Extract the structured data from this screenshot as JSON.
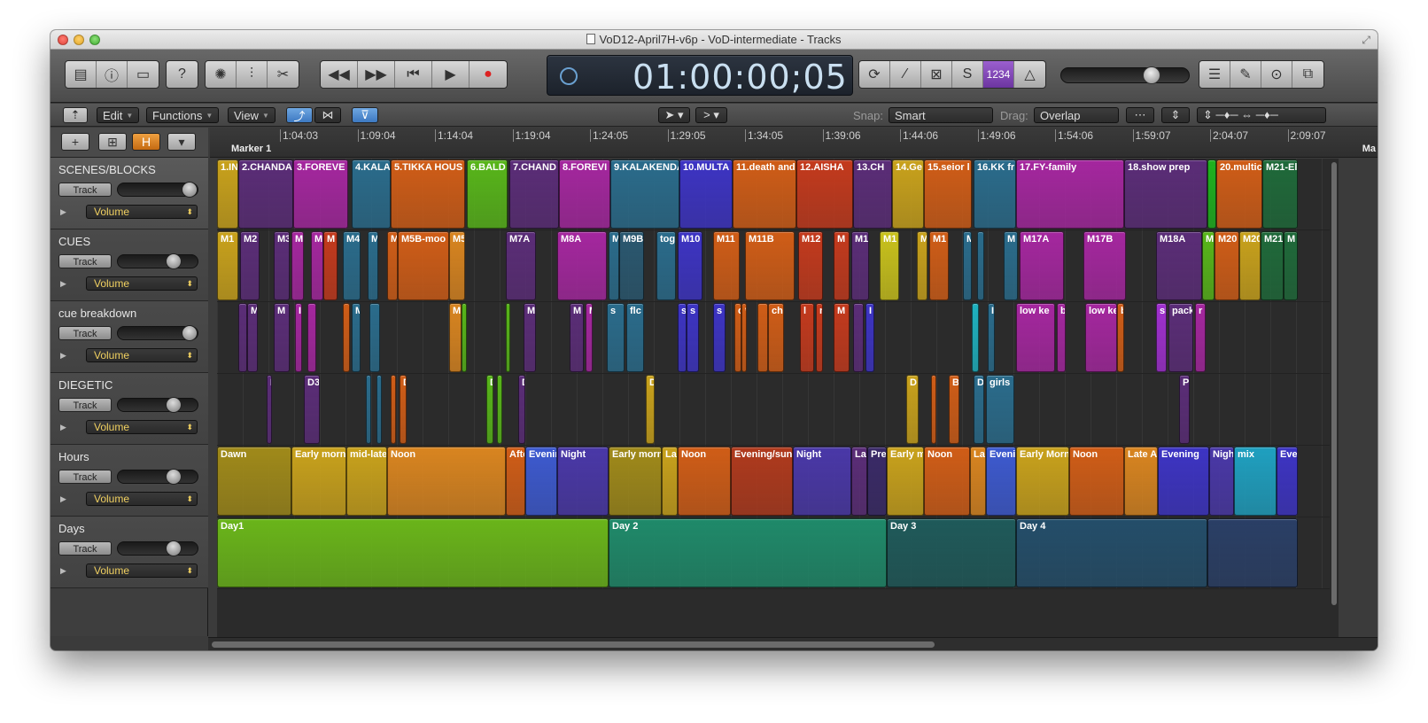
{
  "window": {
    "title": "VoD12-April7H-v6p - VoD-intermediate - Tracks"
  },
  "transport": {
    "time": "01:00:00;05",
    "count_in": "1234"
  },
  "menus": {
    "edit": "Edit",
    "functions": "Functions",
    "view": "View"
  },
  "snap": {
    "label": "Snap:",
    "value": "Smart"
  },
  "drag": {
    "label": "Drag:",
    "value": "Overlap"
  },
  "ruler": {
    "ticks": [
      "1:04:03",
      "1:09:04",
      "1:14:04",
      "1:19:04",
      "1:24:05",
      "1:29:05",
      "1:34:05",
      "1:39:06",
      "1:44:06",
      "1:49:06",
      "1:54:06",
      "1:59:07",
      "2:04:07",
      "2:09:07"
    ],
    "marker": "Marker 1",
    "marker_right": "Ma"
  },
  "tracks": [
    {
      "name": "SCENES/BLOCKS",
      "track_btn": "Track",
      "automation": "Volume",
      "knob": 1.0
    },
    {
      "name": "CUES",
      "track_btn": "Track",
      "automation": "Volume",
      "knob": 0.75
    },
    {
      "name": "cue breakdown",
      "track_btn": "Track",
      "automation": "Volume",
      "knob": 1.0
    },
    {
      "name": "DIEGETIC",
      "track_btn": "Track",
      "automation": "Volume",
      "knob": 0.75
    },
    {
      "name": "Hours",
      "track_btn": "Track",
      "automation": "Volume",
      "knob": 0.75
    },
    {
      "name": "Days",
      "track_btn": "Track",
      "automation": "Volume",
      "knob": 0.75
    }
  ],
  "regions": [
    {
      "track": 0,
      "start": 0,
      "end": 24,
      "label": "1.IN",
      "color": "#c9a21c"
    },
    {
      "track": 0,
      "start": 24,
      "end": 86,
      "label": "2.CHANDA",
      "color": "#5b2d78"
    },
    {
      "track": 0,
      "start": 86,
      "end": 148,
      "label": "3.FOREVE",
      "color": "#a5279f"
    },
    {
      "track": 0,
      "start": 152,
      "end": 196,
      "label": "4.KALA",
      "color": "#2a6c8c"
    },
    {
      "track": 0,
      "start": 196,
      "end": 280,
      "label": "5.TIKKA HOUS",
      "color": "#d05d17"
    },
    {
      "track": 0,
      "start": 282,
      "end": 328,
      "label": "6.BALD",
      "color": "#58b61a"
    },
    {
      "track": 0,
      "start": 330,
      "end": 386,
      "label": "7.CHAND",
      "color": "#5b2d78"
    },
    {
      "track": 0,
      "start": 386,
      "end": 444,
      "label": "8.FOREVI",
      "color": "#a5279f"
    },
    {
      "track": 0,
      "start": 444,
      "end": 522,
      "label": "9.KALAKENDA",
      "color": "#2a6c8c"
    },
    {
      "track": 0,
      "start": 522,
      "end": 582,
      "label": "10.MULTA",
      "color": "#3d34c4"
    },
    {
      "track": 0,
      "start": 582,
      "end": 654,
      "label": "11.death and",
      "color": "#d05d17"
    },
    {
      "track": 0,
      "start": 654,
      "end": 718,
      "label": "12.AISHA",
      "color": "#c43a1d"
    },
    {
      "track": 0,
      "start": 718,
      "end": 762,
      "label": "13.CH",
      "color": "#5b2d78"
    },
    {
      "track": 0,
      "start": 762,
      "end": 798,
      "label": "14.Ge",
      "color": "#c9a21c"
    },
    {
      "track": 0,
      "start": 798,
      "end": 852,
      "label": "15.seior l",
      "color": "#d05d17"
    },
    {
      "track": 0,
      "start": 854,
      "end": 902,
      "label": "16.KK fr",
      "color": "#2a6c8c"
    },
    {
      "track": 0,
      "start": 902,
      "end": 1024,
      "label": "17.FY-family",
      "color": "#a5279f"
    },
    {
      "track": 0,
      "start": 1024,
      "end": 1118,
      "label": "18.show prep",
      "color": "#5b2d78"
    },
    {
      "track": 0,
      "start": 1118,
      "end": 1128,
      "label": "",
      "color": "#1fb21f"
    },
    {
      "track": 0,
      "start": 1128,
      "end": 1180,
      "label": "20.multic",
      "color": "#d05d17"
    },
    {
      "track": 0,
      "start": 1180,
      "end": 1220,
      "label": "M21-El",
      "color": "#1f6a3a"
    },
    {
      "track": 1,
      "start": 0,
      "end": 24,
      "label": "M1",
      "color": "#c9a21c"
    },
    {
      "track": 1,
      "start": 26,
      "end": 48,
      "label": "M2",
      "color": "#5b2d78"
    },
    {
      "track": 1,
      "start": 64,
      "end": 82,
      "label": "M3",
      "color": "#5b2d78"
    },
    {
      "track": 1,
      "start": 84,
      "end": 98,
      "label": "M",
      "color": "#a5279f"
    },
    {
      "track": 1,
      "start": 106,
      "end": 120,
      "label": "M",
      "color": "#a5279f"
    },
    {
      "track": 1,
      "start": 120,
      "end": 136,
      "label": "M",
      "color": "#c43a1d"
    },
    {
      "track": 1,
      "start": 142,
      "end": 162,
      "label": "M4",
      "color": "#2a6c8c"
    },
    {
      "track": 1,
      "start": 170,
      "end": 182,
      "label": "M",
      "color": "#2a6c8c"
    },
    {
      "track": 1,
      "start": 192,
      "end": 204,
      "label": "M",
      "color": "#d05d17"
    },
    {
      "track": 1,
      "start": 204,
      "end": 262,
      "label": "M5B-moo",
      "color": "#d05d17"
    },
    {
      "track": 1,
      "start": 262,
      "end": 280,
      "label": "M5",
      "color": "#d98520"
    },
    {
      "track": 1,
      "start": 326,
      "end": 360,
      "label": "M7A",
      "color": "#5b2d78"
    },
    {
      "track": 1,
      "start": 384,
      "end": 440,
      "label": "M8A",
      "color": "#a5279f"
    },
    {
      "track": 1,
      "start": 442,
      "end": 454,
      "label": "M",
      "color": "#2a6c8c"
    },
    {
      "track": 1,
      "start": 454,
      "end": 482,
      "label": "M9B",
      "color": "#2a5870"
    },
    {
      "track": 1,
      "start": 496,
      "end": 518,
      "label": "tog",
      "color": "#2a6c8c"
    },
    {
      "track": 1,
      "start": 520,
      "end": 548,
      "label": "M10",
      "color": "#3d34c4"
    },
    {
      "track": 1,
      "start": 560,
      "end": 590,
      "label": "M11",
      "color": "#d05d17"
    },
    {
      "track": 1,
      "start": 596,
      "end": 652,
      "label": "M11B",
      "color": "#d05d17"
    },
    {
      "track": 1,
      "start": 656,
      "end": 684,
      "label": "M12",
      "color": "#c43a1d"
    },
    {
      "track": 1,
      "start": 696,
      "end": 714,
      "label": "M",
      "color": "#c43a1d"
    },
    {
      "track": 1,
      "start": 716,
      "end": 736,
      "label": "M1",
      "color": "#5b2d78"
    },
    {
      "track": 1,
      "start": 748,
      "end": 770,
      "label": "M1",
      "color": "#c9c21c"
    },
    {
      "track": 1,
      "start": 790,
      "end": 802,
      "label": "M",
      "color": "#c9a21c"
    },
    {
      "track": 1,
      "start": 804,
      "end": 826,
      "label": "M1",
      "color": "#d05d17"
    },
    {
      "track": 1,
      "start": 842,
      "end": 852,
      "label": "M",
      "color": "#2a6c8c"
    },
    {
      "track": 1,
      "start": 858,
      "end": 866,
      "label": "",
      "color": "#2a6c8c"
    },
    {
      "track": 1,
      "start": 888,
      "end": 904,
      "label": "M",
      "color": "#2a6c8c"
    },
    {
      "track": 1,
      "start": 906,
      "end": 956,
      "label": "M17A",
      "color": "#a5279f"
    },
    {
      "track": 1,
      "start": 978,
      "end": 1026,
      "label": "M17B",
      "color": "#a5279f"
    },
    {
      "track": 1,
      "start": 1060,
      "end": 1112,
      "label": "M18A",
      "color": "#5b2d78"
    },
    {
      "track": 1,
      "start": 1112,
      "end": 1126,
      "label": "M",
      "color": "#58b61a"
    },
    {
      "track": 1,
      "start": 1126,
      "end": 1154,
      "label": "M20",
      "color": "#d05d17"
    },
    {
      "track": 1,
      "start": 1154,
      "end": 1178,
      "label": "M20",
      "color": "#c9a21c"
    },
    {
      "track": 1,
      "start": 1178,
      "end": 1204,
      "label": "M21",
      "color": "#1f6a3a"
    },
    {
      "track": 1,
      "start": 1204,
      "end": 1220,
      "label": "M",
      "color": "#1f6a3a"
    },
    {
      "track": 2,
      "start": 24,
      "end": 34,
      "label": "",
      "color": "#5b2d78"
    },
    {
      "track": 2,
      "start": 34,
      "end": 46,
      "label": "M",
      "color": "#5b2d78"
    },
    {
      "track": 2,
      "start": 64,
      "end": 82,
      "label": "M",
      "color": "#5b2d78"
    },
    {
      "track": 2,
      "start": 88,
      "end": 96,
      "label": "I",
      "color": "#a5279f"
    },
    {
      "track": 2,
      "start": 102,
      "end": 112,
      "label": "",
      "color": "#a5279f"
    },
    {
      "track": 2,
      "start": 142,
      "end": 150,
      "label": "",
      "color": "#d05d17"
    },
    {
      "track": 2,
      "start": 152,
      "end": 162,
      "label": "M",
      "color": "#2a6c8c"
    },
    {
      "track": 2,
      "start": 172,
      "end": 184,
      "label": "",
      "color": "#2a6c8c"
    },
    {
      "track": 2,
      "start": 262,
      "end": 276,
      "label": "M",
      "color": "#d98520"
    },
    {
      "track": 2,
      "start": 276,
      "end": 282,
      "label": "",
      "color": "#58b61a"
    },
    {
      "track": 2,
      "start": 326,
      "end": 330,
      "label": "",
      "color": "#58b61a"
    },
    {
      "track": 2,
      "start": 346,
      "end": 360,
      "label": "M",
      "color": "#5b2d78"
    },
    {
      "track": 2,
      "start": 398,
      "end": 414,
      "label": "M",
      "color": "#5b2d78"
    },
    {
      "track": 2,
      "start": 416,
      "end": 424,
      "label": "M",
      "color": "#a5279f"
    },
    {
      "track": 2,
      "start": 440,
      "end": 460,
      "label": "s",
      "color": "#2a6c8c"
    },
    {
      "track": 2,
      "start": 462,
      "end": 482,
      "label": "flc",
      "color": "#2a6c8c"
    },
    {
      "track": 2,
      "start": 520,
      "end": 530,
      "label": "s",
      "color": "#3d34c4"
    },
    {
      "track": 2,
      "start": 530,
      "end": 544,
      "label": "s",
      "color": "#3d34c4"
    },
    {
      "track": 2,
      "start": 560,
      "end": 574,
      "label": "s",
      "color": "#3d34c4"
    },
    {
      "track": 2,
      "start": 584,
      "end": 592,
      "label": "c",
      "color": "#d05d17"
    },
    {
      "track": 2,
      "start": 592,
      "end": 598,
      "label": "*",
      "color": "#d05d17"
    },
    {
      "track": 2,
      "start": 610,
      "end": 622,
      "label": "",
      "color": "#d05d17"
    },
    {
      "track": 2,
      "start": 622,
      "end": 640,
      "label": "cha",
      "color": "#d05d17"
    },
    {
      "track": 2,
      "start": 658,
      "end": 674,
      "label": "l",
      "color": "#c43a1d"
    },
    {
      "track": 2,
      "start": 676,
      "end": 684,
      "label": "n",
      "color": "#c43a1d"
    },
    {
      "track": 2,
      "start": 696,
      "end": 714,
      "label": "M",
      "color": "#c43a1d"
    },
    {
      "track": 2,
      "start": 718,
      "end": 730,
      "label": "",
      "color": "#5b2d78"
    },
    {
      "track": 2,
      "start": 732,
      "end": 742,
      "label": "I",
      "color": "#3d34c4"
    },
    {
      "track": 2,
      "start": 852,
      "end": 860,
      "label": "",
      "color": "#1fb2c0"
    },
    {
      "track": 2,
      "start": 870,
      "end": 878,
      "label": "I",
      "color": "#2a6c8c"
    },
    {
      "track": 2,
      "start": 902,
      "end": 946,
      "label": "low ke",
      "color": "#a5279f"
    },
    {
      "track": 2,
      "start": 948,
      "end": 958,
      "label": "b",
      "color": "#a5279f"
    },
    {
      "track": 2,
      "start": 980,
      "end": 1016,
      "label": "low ke",
      "color": "#a5279f"
    },
    {
      "track": 2,
      "start": 1016,
      "end": 1024,
      "label": "b",
      "color": "#d05d17"
    },
    {
      "track": 2,
      "start": 1060,
      "end": 1072,
      "label": "sl",
      "color": "#a030d0"
    },
    {
      "track": 2,
      "start": 1074,
      "end": 1102,
      "label": "pack",
      "color": "#5b2d78"
    },
    {
      "track": 2,
      "start": 1104,
      "end": 1116,
      "label": "r",
      "color": "#a5279f"
    },
    {
      "track": 3,
      "start": 56,
      "end": 62,
      "label": "I",
      "color": "#5b2d78"
    },
    {
      "track": 3,
      "start": 98,
      "end": 116,
      "label": "D3",
      "color": "#5b2d78"
    },
    {
      "track": 3,
      "start": 168,
      "end": 174,
      "label": "",
      "color": "#2a6c8c"
    },
    {
      "track": 3,
      "start": 180,
      "end": 186,
      "label": "",
      "color": "#2a6c8c"
    },
    {
      "track": 3,
      "start": 196,
      "end": 202,
      "label": "",
      "color": "#d05d17"
    },
    {
      "track": 3,
      "start": 206,
      "end": 214,
      "label": "D",
      "color": "#d05d17"
    },
    {
      "track": 3,
      "start": 304,
      "end": 312,
      "label": "D",
      "color": "#58b61a"
    },
    {
      "track": 3,
      "start": 316,
      "end": 322,
      "label": "",
      "color": "#58b61a"
    },
    {
      "track": 3,
      "start": 340,
      "end": 348,
      "label": "D",
      "color": "#5b2d78"
    },
    {
      "track": 3,
      "start": 484,
      "end": 494,
      "label": "D",
      "color": "#c9a21c"
    },
    {
      "track": 3,
      "start": 778,
      "end": 792,
      "label": "D",
      "color": "#c9a21c"
    },
    {
      "track": 3,
      "start": 806,
      "end": 812,
      "label": "",
      "color": "#d05d17"
    },
    {
      "track": 3,
      "start": 826,
      "end": 838,
      "label": "B",
      "color": "#d05d17"
    },
    {
      "track": 3,
      "start": 854,
      "end": 866,
      "label": "D",
      "color": "#2a6c8c"
    },
    {
      "track": 3,
      "start": 868,
      "end": 900,
      "label": "girls",
      "color": "#2a6c8c"
    },
    {
      "track": 3,
      "start": 1086,
      "end": 1098,
      "label": "P",
      "color": "#5b2d78"
    },
    {
      "track": 4,
      "start": 0,
      "end": 84,
      "label": "Dawn",
      "color": "#a08a1a"
    },
    {
      "track": 4,
      "start": 84,
      "end": 146,
      "label": "Early morn",
      "color": "#c9a21c"
    },
    {
      "track": 4,
      "start": 146,
      "end": 192,
      "label": "mid-late",
      "color": "#c9a21c"
    },
    {
      "track": 4,
      "start": 192,
      "end": 326,
      "label": "Noon",
      "color": "#d98520"
    },
    {
      "track": 4,
      "start": 326,
      "end": 348,
      "label": "Afte",
      "color": "#d05d17"
    },
    {
      "track": 4,
      "start": 348,
      "end": 384,
      "label": "Evenin",
      "color": "#3d5ad0"
    },
    {
      "track": 4,
      "start": 384,
      "end": 442,
      "label": "Night",
      "color": "#4a38a8"
    },
    {
      "track": 4,
      "start": 442,
      "end": 502,
      "label": "Early morn",
      "color": "#a08a1a"
    },
    {
      "track": 4,
      "start": 502,
      "end": 520,
      "label": "La",
      "color": "#c9a21c"
    },
    {
      "track": 4,
      "start": 520,
      "end": 580,
      "label": "Noon",
      "color": "#d05d17"
    },
    {
      "track": 4,
      "start": 580,
      "end": 650,
      "label": "Evening/sun",
      "color": "#b03a1d"
    },
    {
      "track": 4,
      "start": 650,
      "end": 716,
      "label": "Night",
      "color": "#4a38a8"
    },
    {
      "track": 4,
      "start": 716,
      "end": 734,
      "label": "La",
      "color": "#5b2d78"
    },
    {
      "track": 4,
      "start": 734,
      "end": 756,
      "label": "Pre",
      "color": "#3a2a68"
    },
    {
      "track": 4,
      "start": 756,
      "end": 798,
      "label": "Early m",
      "color": "#c9a21c"
    },
    {
      "track": 4,
      "start": 798,
      "end": 850,
      "label": "Noon",
      "color": "#d05d17"
    },
    {
      "track": 4,
      "start": 850,
      "end": 868,
      "label": "La",
      "color": "#d98520"
    },
    {
      "track": 4,
      "start": 868,
      "end": 902,
      "label": "Eveni",
      "color": "#3d5ad0"
    },
    {
      "track": 4,
      "start": 902,
      "end": 962,
      "label": "Early Morn",
      "color": "#c9a21c"
    },
    {
      "track": 4,
      "start": 962,
      "end": 1024,
      "label": "Noon",
      "color": "#d05d17"
    },
    {
      "track": 4,
      "start": 1024,
      "end": 1062,
      "label": "Late A",
      "color": "#d98520"
    },
    {
      "track": 4,
      "start": 1062,
      "end": 1120,
      "label": "Evening",
      "color": "#3d34c4"
    },
    {
      "track": 4,
      "start": 1120,
      "end": 1148,
      "label": "Nigh",
      "color": "#4a38a8"
    },
    {
      "track": 4,
      "start": 1148,
      "end": 1196,
      "label": "mix",
      "color": "#1fa0c0"
    },
    {
      "track": 4,
      "start": 1196,
      "end": 1220,
      "label": "Eve",
      "color": "#3d34c4"
    },
    {
      "track": 5,
      "start": 0,
      "end": 442,
      "label": "Day1",
      "color": "#6ab51a"
    },
    {
      "track": 5,
      "start": 442,
      "end": 756,
      "label": "Day 2",
      "color": "#1f8a6a"
    },
    {
      "track": 5,
      "start": 756,
      "end": 902,
      "label": "Day 3",
      "color": "#1f5a5a"
    },
    {
      "track": 5,
      "start": 902,
      "end": 1118,
      "label": "Day 4",
      "color": "#244e6a"
    },
    {
      "track": 5,
      "start": 1118,
      "end": 1220,
      "label": "",
      "color": "#2a3f66"
    }
  ]
}
